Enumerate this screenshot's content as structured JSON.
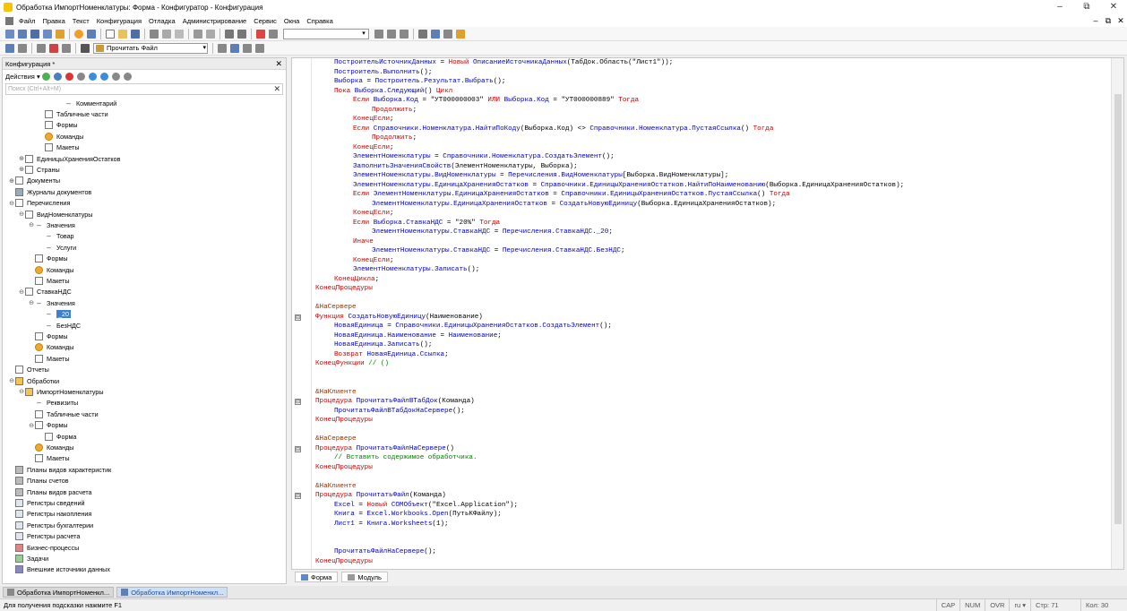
{
  "window": {
    "title": "Обработка ИмпортНоменклатуры: Форма - Конфигуратор - Конфигурация",
    "controls": [
      "–",
      "⧉",
      "✕"
    ]
  },
  "menu": {
    "items": [
      "Файл",
      "Правка",
      "Текст",
      "Конфигурация",
      "Отладка",
      "Администрирование",
      "Сервис",
      "Окна",
      "Справка"
    ],
    "mdi_controls": [
      "–",
      "⧉",
      "✕"
    ]
  },
  "toolbar2": {
    "combo_value": "Прочитать Файл"
  },
  "left_panel": {
    "header": "Конфигурация *",
    "actions_label": "Действия ▾",
    "search_placeholder": "Поиск (Ctrl+Alt+M)"
  },
  "tree": [
    {
      "label": "Комментарий",
      "level": 5,
      "icon": "dash",
      "exp": ""
    },
    {
      "label": "Табличные части",
      "level": 3,
      "icon": "table",
      "exp": ""
    },
    {
      "label": "Формы",
      "level": 3,
      "icon": "form",
      "exp": ""
    },
    {
      "label": "Команды",
      "level": 3,
      "icon": "cmd",
      "exp": ""
    },
    {
      "label": "Макеты",
      "level": 3,
      "icon": "layout",
      "exp": ""
    },
    {
      "label": "ЕдиницыХраненияОстатков",
      "level": 1,
      "icon": "catalog",
      "exp": "⊕"
    },
    {
      "label": "Страны",
      "level": 1,
      "icon": "catalog",
      "exp": "⊕"
    },
    {
      "label": "Документы",
      "level": 0,
      "icon": "docs",
      "exp": "⊕"
    },
    {
      "label": "Журналы документов",
      "level": 0,
      "icon": "journals",
      "exp": ""
    },
    {
      "label": "Перечисления",
      "level": 0,
      "icon": "enum",
      "exp": "⊖"
    },
    {
      "label": "ВидНоменклатуры",
      "level": 1,
      "icon": "enum",
      "exp": "⊖"
    },
    {
      "label": "Значения",
      "level": 2,
      "icon": "dash",
      "exp": "⊖"
    },
    {
      "label": "Товар",
      "level": 3,
      "icon": "dash",
      "exp": ""
    },
    {
      "label": "Услуги",
      "level": 3,
      "icon": "dash",
      "exp": ""
    },
    {
      "label": "Формы",
      "level": 2,
      "icon": "form",
      "exp": ""
    },
    {
      "label": "Команды",
      "level": 2,
      "icon": "cmd",
      "exp": ""
    },
    {
      "label": "Макеты",
      "level": 2,
      "icon": "layout",
      "exp": ""
    },
    {
      "label": "СтавкаНДС",
      "level": 1,
      "icon": "enum",
      "exp": "⊖"
    },
    {
      "label": "Значения",
      "level": 2,
      "icon": "dash",
      "exp": "⊖"
    },
    {
      "label": "_20",
      "level": 3,
      "icon": "dash",
      "exp": "",
      "selected": true
    },
    {
      "label": "БезНДС",
      "level": 3,
      "icon": "dash",
      "exp": ""
    },
    {
      "label": "Формы",
      "level": 2,
      "icon": "form",
      "exp": ""
    },
    {
      "label": "Команды",
      "level": 2,
      "icon": "cmd",
      "exp": ""
    },
    {
      "label": "Макеты",
      "level": 2,
      "icon": "layout",
      "exp": ""
    },
    {
      "label": "Отчеты",
      "level": 0,
      "icon": "reports",
      "exp": ""
    },
    {
      "label": "Обработки",
      "level": 0,
      "icon": "processing",
      "exp": "⊖"
    },
    {
      "label": "ИмпортНоменклатуры",
      "level": 1,
      "icon": "processing",
      "exp": "⊖"
    },
    {
      "label": "Реквизиты",
      "level": 2,
      "icon": "dash",
      "exp": ""
    },
    {
      "label": "Табличные части",
      "level": 2,
      "icon": "table",
      "exp": ""
    },
    {
      "label": "Формы",
      "level": 2,
      "icon": "form",
      "exp": "⊖"
    },
    {
      "label": "Форма",
      "level": 3,
      "icon": "form",
      "exp": ""
    },
    {
      "label": "Команды",
      "level": 2,
      "icon": "cmd",
      "exp": ""
    },
    {
      "label": "Макеты",
      "level": 2,
      "icon": "layout",
      "exp": ""
    },
    {
      "label": "Планы видов характеристик",
      "level": 0,
      "icon": "plan",
      "exp": ""
    },
    {
      "label": "Планы счетов",
      "level": 0,
      "icon": "plan",
      "exp": ""
    },
    {
      "label": "Планы видов расчета",
      "level": 0,
      "icon": "plan",
      "exp": ""
    },
    {
      "label": "Регистры сведений",
      "level": 0,
      "icon": "reg",
      "exp": ""
    },
    {
      "label": "Регистры накопления",
      "level": 0,
      "icon": "reg",
      "exp": ""
    },
    {
      "label": "Регистры бухгалтерии",
      "level": 0,
      "icon": "reg",
      "exp": ""
    },
    {
      "label": "Регистры расчета",
      "level": 0,
      "icon": "reg",
      "exp": ""
    },
    {
      "label": "Бизнес-процессы",
      "level": 0,
      "icon": "bp",
      "exp": ""
    },
    {
      "label": "Задачи",
      "level": 0,
      "icon": "task",
      "exp": ""
    },
    {
      "label": "Внешние источники данных",
      "level": 0,
      "icon": "ext",
      "exp": ""
    }
  ],
  "code_lines": [
    {
      "indent": 1,
      "segs": [
        [
          "id",
          "ПостроительИсточникДанных"
        ],
        [
          "str",
          " = "
        ],
        [
          "kw",
          "Новый "
        ],
        [
          "id",
          "ОписаниеИсточникаДанных"
        ],
        [
          "str",
          "(ТабДок.Область(\"Лист1\"));"
        ]
      ]
    },
    {
      "indent": 1,
      "segs": [
        [
          "id",
          "Построитель.Выполнить"
        ],
        [
          "str",
          "();"
        ]
      ]
    },
    {
      "indent": 1,
      "segs": [
        [
          "id",
          "Выборка"
        ],
        [
          "str",
          " = "
        ],
        [
          "id",
          "Построитель.Результат.Выбрать"
        ],
        [
          "str",
          "();"
        ]
      ]
    },
    {
      "indent": 1,
      "segs": [
        [
          "kw",
          "Пока "
        ],
        [
          "id",
          "Выборка.Следующий"
        ],
        [
          "str",
          "() "
        ],
        [
          "kw",
          "Цикл"
        ]
      ]
    },
    {
      "indent": 2,
      "segs": [
        [
          "kw",
          "Если "
        ],
        [
          "id",
          "Выборка.Код"
        ],
        [
          "str",
          " = \"УТ000000003\" "
        ],
        [
          "kw",
          "ИЛИ "
        ],
        [
          "id",
          "Выборка.Код"
        ],
        [
          "str",
          " = \"УТ000000889\" "
        ],
        [
          "kw",
          "Тогда"
        ]
      ]
    },
    {
      "indent": 3,
      "segs": [
        [
          "kw",
          "Продолжить"
        ],
        [
          "str",
          ";"
        ]
      ]
    },
    {
      "indent": 2,
      "segs": [
        [
          "kw",
          "КонецЕсли"
        ],
        [
          "str",
          ";"
        ]
      ]
    },
    {
      "indent": 2,
      "segs": [
        [
          "kw",
          "Если "
        ],
        [
          "id",
          "Справочники.Номенклатура.НайтиПоКоду"
        ],
        [
          "str",
          "(Выборка.Код) <> "
        ],
        [
          "id",
          "Справочники.Номенклатура.ПустаяСсылка"
        ],
        [
          "str",
          "() "
        ],
        [
          "kw",
          "Тогда"
        ]
      ]
    },
    {
      "indent": 3,
      "segs": [
        [
          "kw",
          "Продолжить"
        ],
        [
          "str",
          ";"
        ]
      ]
    },
    {
      "indent": 2,
      "segs": [
        [
          "kw",
          "КонецЕсли"
        ],
        [
          "str",
          ";"
        ]
      ]
    },
    {
      "indent": 2,
      "segs": [
        [
          "id",
          "ЭлементНоменклатуры"
        ],
        [
          "str",
          " = "
        ],
        [
          "id",
          "Справочники.Номенклатура.СоздатьЭлемент"
        ],
        [
          "str",
          "();"
        ]
      ]
    },
    {
      "indent": 2,
      "segs": [
        [
          "id",
          "ЗаполнитьЗначенияСвойств"
        ],
        [
          "str",
          "(ЭлементНоменклатуры, Выборка);"
        ]
      ]
    },
    {
      "indent": 2,
      "segs": [
        [
          "id",
          "ЭлементНоменклатуры.ВидНоменклатуры"
        ],
        [
          "str",
          " = "
        ],
        [
          "id",
          "Перечисления.ВидНоменклатуры"
        ],
        [
          "str",
          "[Выборка.ВидНоменклатуры];"
        ]
      ]
    },
    {
      "indent": 2,
      "segs": [
        [
          "id",
          "ЭлементНоменклатуры.ЕдиницаХраненияОстатков"
        ],
        [
          "str",
          " = "
        ],
        [
          "id",
          "Справочники.ЕдиницыХраненияОстатков.НайтиПоНаименованию"
        ],
        [
          "str",
          "(Выборка.ЕдиницаХраненияОстатков);"
        ]
      ]
    },
    {
      "indent": 2,
      "segs": [
        [
          "kw",
          "Если "
        ],
        [
          "id",
          "ЭлементНоменклатуры.ЕдиницаХраненияОстатков"
        ],
        [
          "str",
          " = "
        ],
        [
          "id",
          "Справочники.ЕдиницыХраненияОстатков.ПустаяСсылка"
        ],
        [
          "str",
          "() "
        ],
        [
          "kw",
          "Тогда"
        ]
      ]
    },
    {
      "indent": 3,
      "segs": [
        [
          "id",
          "ЭлементНоменклатуры.ЕдиницаХраненияОстатков"
        ],
        [
          "str",
          " = "
        ],
        [
          "id",
          "СоздатьНовуюЕдиницу"
        ],
        [
          "str",
          "(Выборка.ЕдиницаХраненияОстатков);"
        ]
      ]
    },
    {
      "indent": 2,
      "segs": [
        [
          "kw",
          "КонецЕсли"
        ],
        [
          "str",
          ";"
        ]
      ]
    },
    {
      "indent": 2,
      "segs": [
        [
          "kw",
          "Если "
        ],
        [
          "id",
          "Выборка.СтавкаНДС"
        ],
        [
          "str",
          " = \"20%\" "
        ],
        [
          "kw",
          "Тогда"
        ]
      ]
    },
    {
      "indent": 3,
      "segs": [
        [
          "id",
          "ЭлементНоменклатуры.СтавкаНДС"
        ],
        [
          "str",
          " = "
        ],
        [
          "id",
          "Перечисления.СтавкаНДС._20"
        ],
        [
          "str",
          ";"
        ]
      ]
    },
    {
      "indent": 2,
      "segs": [
        [
          "kw",
          "Иначе"
        ]
      ]
    },
    {
      "indent": 3,
      "segs": [
        [
          "id",
          "ЭлементНоменклатуры.СтавкаНДС"
        ],
        [
          "str",
          " = "
        ],
        [
          "id",
          "Перечисления.СтавкаНДС.БезНДС"
        ],
        [
          "str",
          ";"
        ]
      ]
    },
    {
      "indent": 2,
      "segs": [
        [
          "kw",
          "КонецЕсли"
        ],
        [
          "str",
          ";"
        ]
      ]
    },
    {
      "indent": 2,
      "segs": [
        [
          "id",
          "ЭлементНоменклатуры.Записать"
        ],
        [
          "str",
          "();"
        ]
      ]
    },
    {
      "indent": 1,
      "segs": [
        [
          "kw",
          "КонецЦикла"
        ],
        [
          "str",
          ";"
        ]
      ]
    },
    {
      "indent": 0,
      "segs": [
        [
          "kw",
          "КонецПроцедуры"
        ]
      ]
    },
    {
      "indent": 0,
      "segs": []
    },
    {
      "indent": 0,
      "segs": [
        [
          "pp",
          "&НаСервере"
        ]
      ]
    },
    {
      "indent": 0,
      "fold": "⊟",
      "segs": [
        [
          "kw",
          "Функция "
        ],
        [
          "id",
          "СоздатьНовуюЕдиницу"
        ],
        [
          "str",
          "(Наименование)"
        ]
      ]
    },
    {
      "indent": 1,
      "segs": [
        [
          "id",
          "НоваяЕдиница"
        ],
        [
          "str",
          " = "
        ],
        [
          "id",
          "Справочники.ЕдиницыХраненияОстатков.СоздатьЭлемент"
        ],
        [
          "str",
          "();"
        ]
      ]
    },
    {
      "indent": 1,
      "segs": [
        [
          "id",
          "НоваяЕдиница.Наименование"
        ],
        [
          "str",
          " = "
        ],
        [
          "id",
          "Наименование"
        ],
        [
          "str",
          ";"
        ]
      ]
    },
    {
      "indent": 1,
      "segs": [
        [
          "id",
          "НоваяЕдиница.Записать"
        ],
        [
          "str",
          "();"
        ]
      ]
    },
    {
      "indent": 1,
      "segs": [
        [
          "kw",
          "Возврат "
        ],
        [
          "id",
          "НоваяЕдиница.Ссылка"
        ],
        [
          "str",
          ";"
        ]
      ]
    },
    {
      "indent": 0,
      "segs": [
        [
          "kw",
          "КонецФункции"
        ],
        [
          "cmt",
          " // ()"
        ]
      ]
    },
    {
      "indent": 0,
      "segs": []
    },
    {
      "indent": 0,
      "segs": []
    },
    {
      "indent": 0,
      "segs": [
        [
          "pp",
          "&НаКлиенте"
        ]
      ]
    },
    {
      "indent": 0,
      "fold": "⊟",
      "segs": [
        [
          "kw",
          "Процедура "
        ],
        [
          "id",
          "ПрочитатьФайлВТабДок"
        ],
        [
          "str",
          "(Команда)"
        ]
      ]
    },
    {
      "indent": 1,
      "segs": [
        [
          "id",
          "ПрочитатьФайлВТабДокНаСервере"
        ],
        [
          "str",
          "();"
        ]
      ]
    },
    {
      "indent": 0,
      "segs": [
        [
          "kw",
          "КонецПроцедуры"
        ]
      ]
    },
    {
      "indent": 0,
      "segs": []
    },
    {
      "indent": 0,
      "segs": [
        [
          "pp",
          "&НаСервере"
        ]
      ]
    },
    {
      "indent": 0,
      "fold": "⊟",
      "segs": [
        [
          "kw",
          "Процедура "
        ],
        [
          "id",
          "ПрочитатьФайлНаСервере"
        ],
        [
          "str",
          "()"
        ]
      ]
    },
    {
      "indent": 1,
      "segs": [
        [
          "cmt",
          "// Вставить содержимое обработчика."
        ]
      ]
    },
    {
      "indent": 0,
      "segs": [
        [
          "kw",
          "КонецПроцедуры"
        ]
      ]
    },
    {
      "indent": 0,
      "segs": []
    },
    {
      "indent": 0,
      "segs": [
        [
          "pp",
          "&НаКлиенте"
        ]
      ]
    },
    {
      "indent": 0,
      "fold": "⊟",
      "segs": [
        [
          "kw",
          "Процедура "
        ],
        [
          "id",
          "ПрочитатьФайл"
        ],
        [
          "str",
          "(Команда)"
        ]
      ]
    },
    {
      "indent": 1,
      "segs": [
        [
          "id",
          "Excel"
        ],
        [
          "str",
          " = "
        ],
        [
          "kw",
          "Новый "
        ],
        [
          "id",
          "COMОбъект"
        ],
        [
          "str",
          "(\"Excel.Application\");"
        ]
      ]
    },
    {
      "indent": 1,
      "segs": [
        [
          "id",
          "Книга"
        ],
        [
          "str",
          " = "
        ],
        [
          "id",
          "Excel.Workbooks.Open"
        ],
        [
          "str",
          "(ПутьКФайлу);"
        ]
      ]
    },
    {
      "indent": 1,
      "segs": [
        [
          "id",
          "Лист1"
        ],
        [
          "str",
          " = "
        ],
        [
          "id",
          "Книга.Worksheets"
        ],
        [
          "str",
          "(1);"
        ]
      ]
    },
    {
      "indent": 0,
      "segs": []
    },
    {
      "indent": 0,
      "segs": []
    },
    {
      "indent": 1,
      "segs": [
        [
          "id",
          "ПрочитатьФайлНаСервере"
        ],
        [
          "str",
          "();"
        ]
      ]
    },
    {
      "indent": 0,
      "segs": [
        [
          "kw",
          "КонецПроцедуры"
        ]
      ]
    }
  ],
  "editor_tabs": [
    "Форма",
    "Модуль"
  ],
  "window_tabs": [
    "Обработка ИмпортНоменкл...",
    "Обработка ИмпортНоменкл..."
  ],
  "status": {
    "hint": "Для получения подсказки нажмите F1",
    "cap": "CAP",
    "num": "NUM",
    "ovr": "OVR",
    "lang": "ru ▾",
    "line": "Стр: 71",
    "col": "Кол: 30"
  },
  "colors": {
    "keyword": "#cc0000",
    "identifier": "#0000cc",
    "comment": "#008000",
    "preprocessor": "#963200",
    "selection": "#3d7fd4"
  }
}
